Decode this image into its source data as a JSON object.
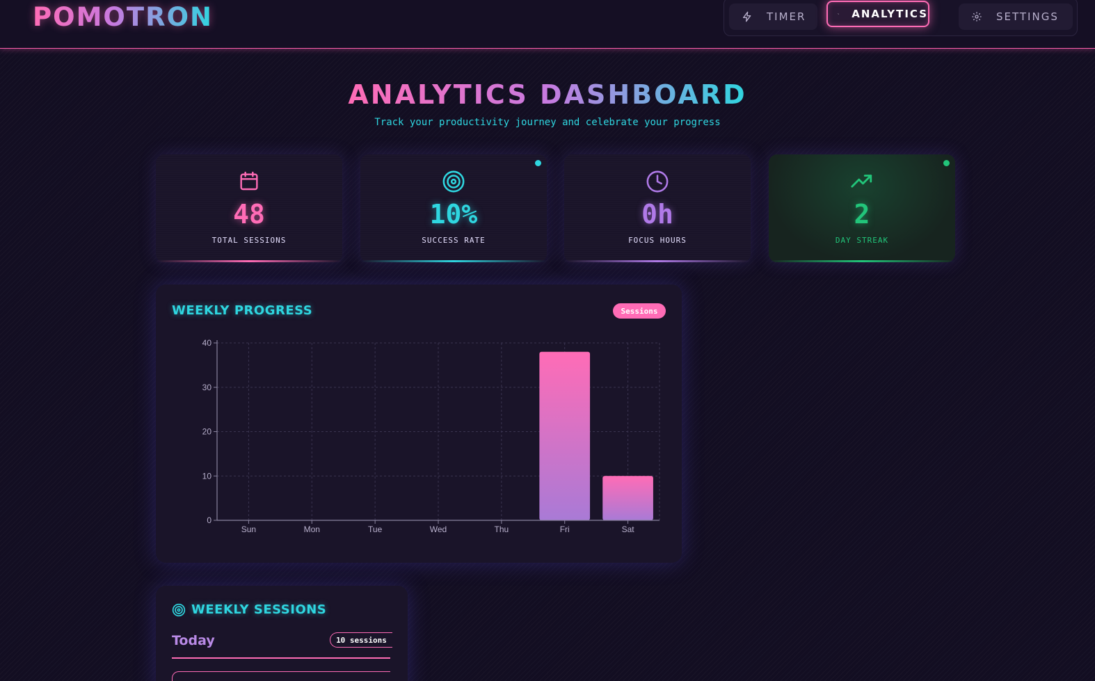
{
  "app": {
    "title": "POMOTRON"
  },
  "nav": [
    {
      "label": "TIMER",
      "icon": "bolt-icon"
    },
    {
      "label": "ANALYTICS",
      "icon": "activity-icon",
      "active": true
    },
    {
      "label": "SETTINGS",
      "icon": "gear-icon"
    }
  ],
  "header": {
    "title": "ANALYTICS DASHBOARD",
    "subtitle": "Track your productivity journey and celebrate your progress"
  },
  "stats": [
    {
      "value": "48",
      "label": "TOTAL SESSIONS",
      "icon": "calendar-icon",
      "color": "#ff6cb6"
    },
    {
      "value": "10%",
      "label": "SUCCESS RATE",
      "icon": "target-icon",
      "color": "#2fd6e0"
    },
    {
      "value": "0h",
      "label": "FOCUS HOURS",
      "icon": "clock-icon",
      "color": "#b07ae8"
    },
    {
      "value": "2",
      "label": "DAY STREAK",
      "icon": "trending-up-icon",
      "color": "#22c57a"
    }
  ],
  "weekly_progress": {
    "title": "WEEKLY PROGRESS",
    "badge": "Sessions"
  },
  "chart_data": {
    "type": "bar",
    "categories": [
      "Sun",
      "Mon",
      "Tue",
      "Wed",
      "Thu",
      "Fri",
      "Sat"
    ],
    "values": [
      0,
      0,
      0,
      0,
      0,
      38,
      10
    ],
    "title": "WEEKLY PROGRESS",
    "xlabel": "",
    "ylabel": "",
    "ylim": [
      0,
      40
    ],
    "yticks": [
      0,
      10,
      20,
      30,
      40
    ],
    "grid": true,
    "bar_gradient": [
      "#ff6cb6",
      "#a97ad6"
    ]
  },
  "weekly_sessions": {
    "title": "WEEKLY SESSIONS",
    "icon": "target-icon",
    "day_label": "Today",
    "count": "10 sessions"
  }
}
